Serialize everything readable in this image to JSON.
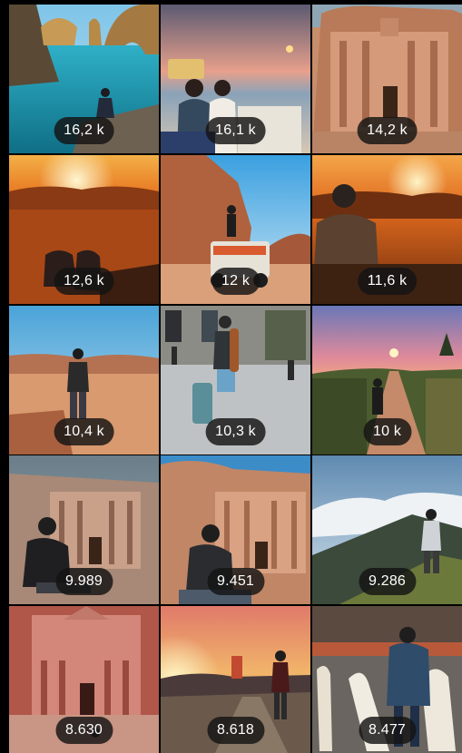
{
  "grid": {
    "tiles": [
      {
        "count": "16,2 k",
        "image": "coastal-rock-arches-photo"
      },
      {
        "count": "16,1 k",
        "image": "couple-at-beach-table-photo"
      },
      {
        "count": "14,2 k",
        "image": "petra-monastery-photo"
      },
      {
        "count": "12,6 k",
        "image": "desert-sunset-feet-photo"
      },
      {
        "count": "12 k",
        "image": "desert-jeep-photo"
      },
      {
        "count": "11,6 k",
        "image": "man-watching-desert-sunset-photo"
      },
      {
        "count": "10,4 k",
        "image": "man-in-wadi-rum-photo"
      },
      {
        "count": "10,3 k",
        "image": "street-skateboard-suitcase-photo"
      },
      {
        "count": "10 k",
        "image": "road-at-sunset-photo"
      },
      {
        "count": "9.989",
        "image": "petra-treasury-sitting-photo"
      },
      {
        "count": "9.451",
        "image": "petra-monastery-sitting-photo"
      },
      {
        "count": "9.286",
        "image": "volcano-hiker-photo"
      },
      {
        "count": "8.630",
        "image": "petra-treasury-photo"
      },
      {
        "count": "8.618",
        "image": "lighthouse-sunset-photo"
      },
      {
        "count": "8.477",
        "image": "surfboards-beach-shack-photo"
      }
    ]
  }
}
